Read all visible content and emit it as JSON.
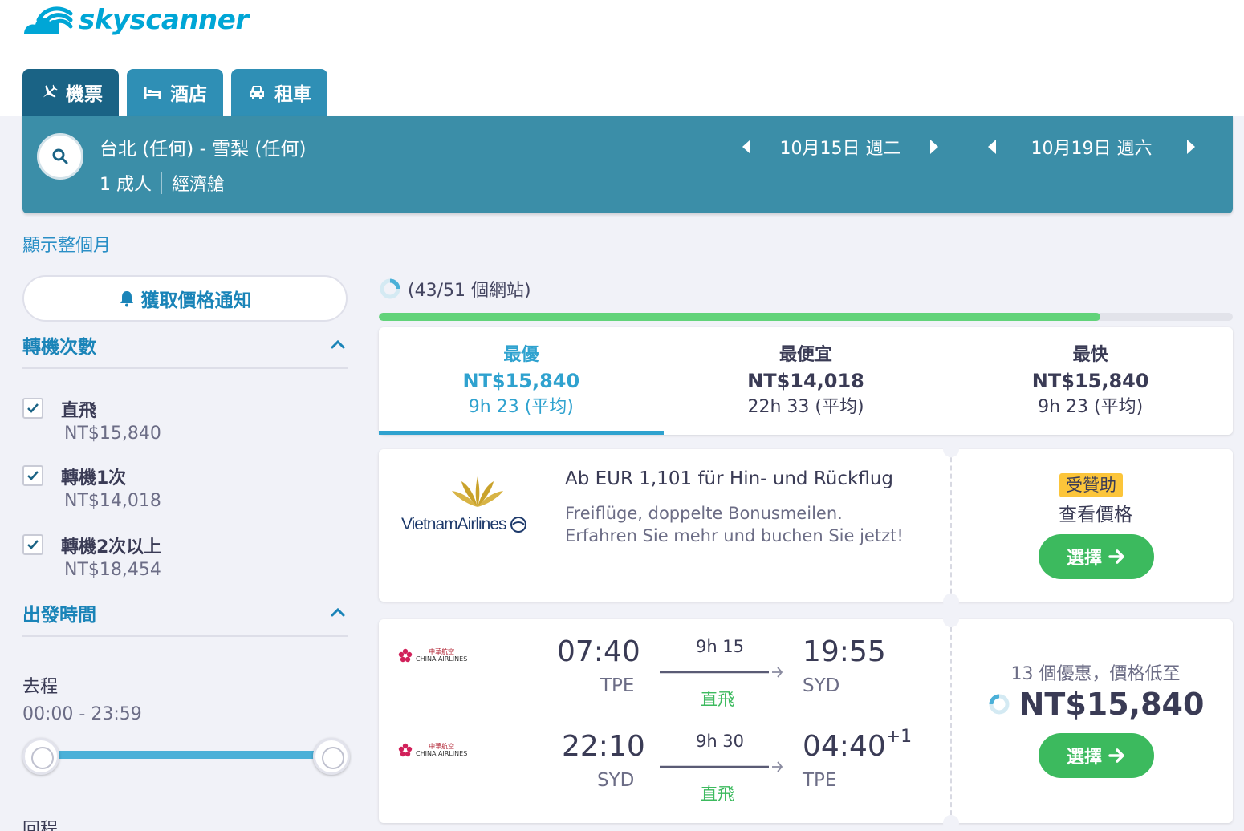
{
  "brand": {
    "name": "skyscanner",
    "color": "#00a6d6"
  },
  "tabs": [
    {
      "label": "機票",
      "icon": "plane-icon",
      "active": true
    },
    {
      "label": "酒店",
      "icon": "bed-icon",
      "active": false
    },
    {
      "label": "租車",
      "icon": "car-icon",
      "active": false
    }
  ],
  "search": {
    "route": "台北 (任何) - 雪梨 (任何)",
    "passengers": "1 成人",
    "cabin": "經濟艙",
    "depart_date": "10月15日 週二",
    "return_date": "10月19日 週六"
  },
  "month_link": "顯示整個月",
  "sidebar": {
    "alert_button": "獲取價格通知",
    "stops_title": "轉機次數",
    "stops": [
      {
        "label": "直飛",
        "price": "NT$15,840",
        "checked": true
      },
      {
        "label": "轉機1次",
        "price": "NT$14,018",
        "checked": true
      },
      {
        "label": "轉機2次以上",
        "price": "NT$18,454",
        "checked": true
      }
    ],
    "departure_title": "出發時間",
    "outbound_label": "去程",
    "outbound_range": "00:00 - 23:59",
    "return_label": "回程"
  },
  "results": {
    "sites_status": "(43/51 個網站)",
    "progress": 0.845,
    "sort": [
      {
        "title": "最優",
        "price": "NT$15,840",
        "duration": "9h 23 (平均)",
        "active": true
      },
      {
        "title": "最便宜",
        "price": "NT$14,018",
        "duration": "22h 33 (平均)",
        "active": false
      },
      {
        "title": "最快",
        "price": "NT$15,840",
        "duration": "9h 23 (平均)",
        "active": false
      }
    ]
  },
  "ad": {
    "airline_logo_text": "VietnamAirlines",
    "title": "Ab EUR 1,101 für Hin- und Rückflug",
    "desc_line1": "Freiflüge, doppelte Bonusmeilen.",
    "desc_line2": "Erfahren Sie mehr und buchen Sie jetzt!",
    "sponsored": "受贊助",
    "view_price": "查看價格",
    "select": "選擇"
  },
  "flight": {
    "airline_logo_text": "CHINA AIRLINES",
    "airline_logo_cn": "中華航空",
    "legs": [
      {
        "dep_time": "07:40",
        "dep_code": "TPE",
        "duration": "9h 15",
        "stops": "直飛",
        "arr_time": "19:55",
        "arr_code": "SYD",
        "day_offset": ""
      },
      {
        "dep_time": "22:10",
        "dep_code": "SYD",
        "duration": "9h 30",
        "stops": "直飛",
        "arr_time": "04:40",
        "arr_code": "TPE",
        "day_offset": "+1"
      }
    ],
    "deals": "13 個優惠，價格低至",
    "price": "NT$15,840",
    "select": "選擇"
  },
  "colors": {
    "header_blue": "#3b8ea8",
    "tab_active": "#1a6385",
    "tab_inactive": "#2f8fb5",
    "link_blue": "#2a8fc6",
    "green": "#3cba5e",
    "progress_green": "#62d37a",
    "sponsored_yellow": "#fcc53a"
  }
}
